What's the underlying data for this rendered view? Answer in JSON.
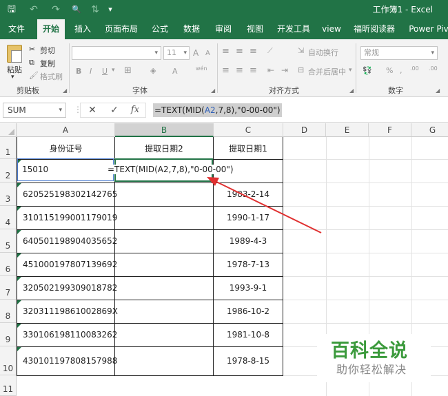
{
  "window": {
    "title": "工作簿1  -  Excel"
  },
  "quick_access": {
    "save": "🖫",
    "undo": "↶",
    "redo": "↷",
    "preview": "🔍",
    "sort": "⇅",
    "customize": "▾"
  },
  "tabs": [
    "文件",
    "开始",
    "插入",
    "页面布局",
    "公式",
    "数据",
    "审阅",
    "视图",
    "开发工具",
    "view",
    "福昕阅读器",
    "Power Pivot"
  ],
  "active_tab": "开始",
  "ribbon": {
    "clipboard": {
      "label": "剪贴板",
      "paste": "粘贴",
      "cut": "剪切",
      "copy": "复制",
      "format_painter": "格式刷"
    },
    "font": {
      "label": "字体",
      "bold": "B",
      "italic": "I",
      "underline": "U",
      "increase": "A",
      "decrease": "A",
      "font_color": "A",
      "wen": "wén",
      "size": "11"
    },
    "alignment": {
      "label": "对齐方式",
      "wrap": "自动换行",
      "merge": "合并后居中"
    },
    "number": {
      "label": "数字",
      "format": "常规",
      "percent": "%",
      "comma": ",",
      "inc_decimal": ".00",
      "dec_decimal": ".00"
    }
  },
  "formula_bar": {
    "name_box": "SUM",
    "cancel": "✕",
    "enter": "✓",
    "fx": "fx",
    "formula_prefix": "=TEXT(MID(",
    "formula_ref": "A2",
    "formula_suffix": ",7,8),\"0-00-00\")"
  },
  "sheet": {
    "columns": [
      "A",
      "B",
      "C",
      "D",
      "E",
      "F",
      "G"
    ],
    "rows": [
      "1",
      "2",
      "3",
      "4",
      "5",
      "6",
      "7",
      "8",
      "9",
      "10",
      "11"
    ],
    "headers": {
      "a": "身份证号",
      "b": "提取日期2",
      "c": "提取日期1"
    },
    "a2_partial": "15010",
    "editing_formula": "=TEXT(MID(A2,7,8),\"0-00-00\")",
    "data": [
      {
        "id": "620525198302142765",
        "date": "1983-2-14"
      },
      {
        "id": "310115199001179019",
        "date": "1990-1-17"
      },
      {
        "id": "640501198904035652",
        "date": "1989-4-3"
      },
      {
        "id": "451000197807139692",
        "date": "1978-7-13"
      },
      {
        "id": "320502199309018782",
        "date": "1993-9-1"
      },
      {
        "id": "32031119861002869X",
        "date": "1986-10-2"
      },
      {
        "id": "330106198110083262",
        "date": "1981-10-8"
      },
      {
        "id": "430101197808157988",
        "date": "1978-8-15"
      }
    ]
  },
  "watermark": {
    "title": "百科全说",
    "subtitle": "助你轻松解决"
  },
  "colors": {
    "excel_green": "#217346",
    "ref_blue": "#4a7bd0",
    "arrow_red": "#e03030"
  }
}
